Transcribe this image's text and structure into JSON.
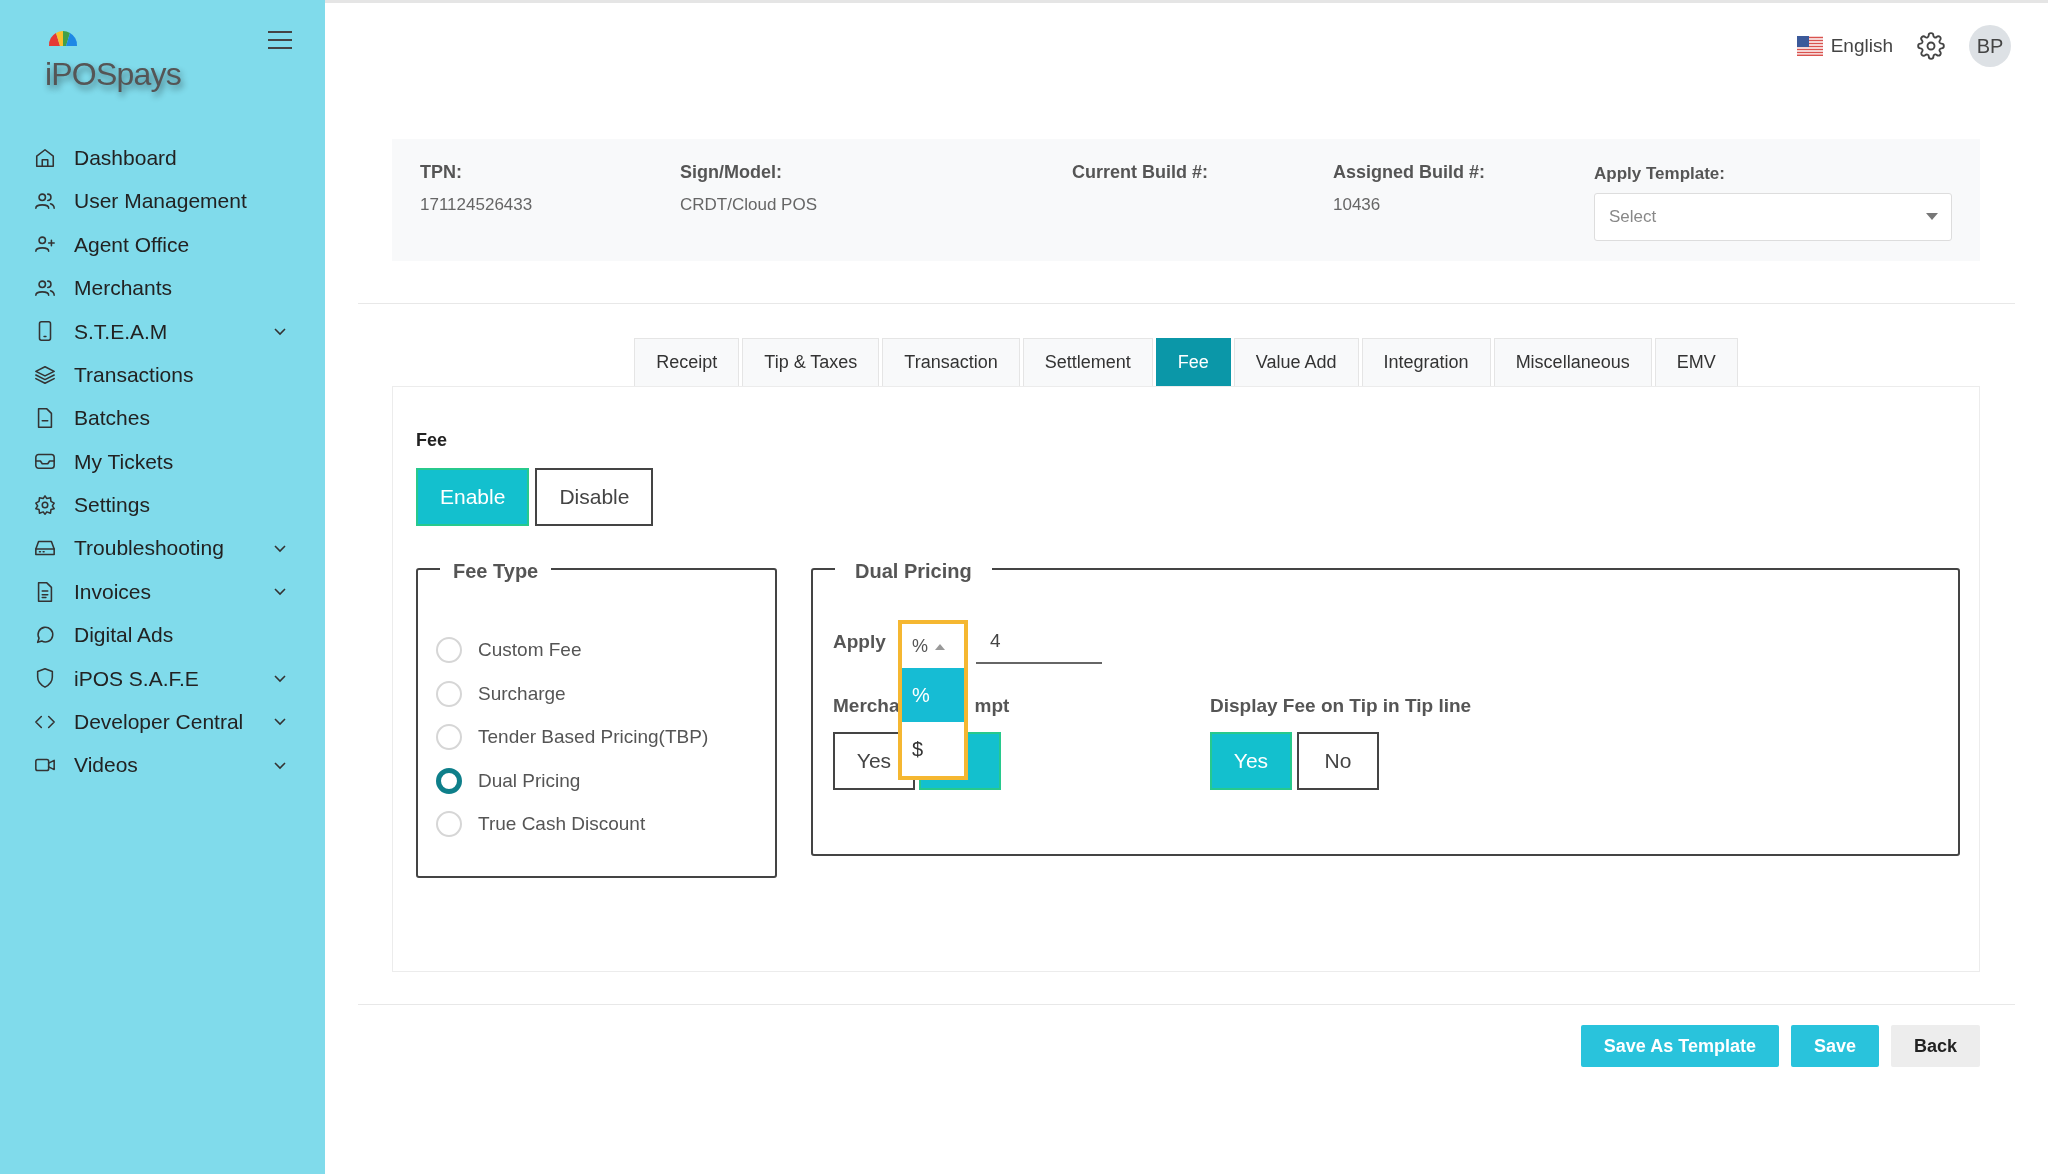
{
  "sidebar": {
    "logo": "iPOSpays",
    "items": [
      {
        "label": "Dashboard",
        "expandable": false
      },
      {
        "label": "User Management",
        "expandable": false
      },
      {
        "label": "Agent Office",
        "expandable": false
      },
      {
        "label": "Merchants",
        "expandable": false
      },
      {
        "label": "S.T.E.A.M",
        "expandable": true
      },
      {
        "label": "Transactions",
        "expandable": false
      },
      {
        "label": "Batches",
        "expandable": false
      },
      {
        "label": "My Tickets",
        "expandable": false
      },
      {
        "label": "Settings",
        "expandable": false
      },
      {
        "label": "Troubleshooting",
        "expandable": true
      },
      {
        "label": "Invoices",
        "expandable": true
      },
      {
        "label": "Digital Ads",
        "expandable": false
      },
      {
        "label": "iPOS S.A.F.E",
        "expandable": true
      },
      {
        "label": "Developer Central",
        "expandable": true
      },
      {
        "label": "Videos",
        "expandable": true
      }
    ]
  },
  "header": {
    "language": "English",
    "avatar": "BP"
  },
  "info": [
    {
      "label": "TPN:",
      "value": "171124526433"
    },
    {
      "label": "Sign/Model:",
      "value": "CRDT/Cloud POS"
    },
    {
      "label": "Current Build #:"
    },
    {
      "label": "Assigned Build #:",
      "value": "10436"
    }
  ],
  "apply_template": {
    "label": "Apply Template:",
    "placeholder": "Select"
  },
  "tabs": [
    {
      "label": "Receipt",
      "selected": false
    },
    {
      "label": "Tip & Taxes",
      "selected": false
    },
    {
      "label": "Transaction",
      "selected": false
    },
    {
      "label": "Settlement",
      "selected": false
    },
    {
      "label": "Fee",
      "selected": true
    },
    {
      "label": "Value Add",
      "selected": false
    },
    {
      "label": "Integration",
      "selected": false
    },
    {
      "label": "Miscellaneous",
      "selected": false
    },
    {
      "label": "EMV",
      "selected": false
    }
  ],
  "fee": {
    "title": "Fee",
    "toggle": [
      {
        "label": "Enable",
        "selected": true
      },
      {
        "label": "Disable",
        "selected": false
      }
    ],
    "fee_type": {
      "legend": "Fee Type",
      "options": [
        {
          "label": "Custom Fee",
          "selected": false
        },
        {
          "label": "Surcharge",
          "selected": false
        },
        {
          "label": "Tender Based Pricing(TBP)",
          "selected": false
        },
        {
          "label": "Dual Pricing",
          "selected": true
        },
        {
          "label": "True Cash Discount",
          "selected": false
        }
      ]
    },
    "dual_pricing": {
      "legend": "Dual Pricing",
      "apply_label": "Apply",
      "unit": "%",
      "value": "4",
      "unit_menu": [
        {
          "label": "%",
          "selected": true
        },
        {
          "label": "$",
          "selected": false
        }
      ],
      "merchant_exempt": {
        "label_parts": [
          "Mercha",
          "mpt"
        ],
        "buttons": [
          {
            "label": "Yes",
            "selected": false
          },
          {
            "selected": true
          }
        ]
      },
      "display_fee": {
        "label": "Display Fee on Tip in Tip line",
        "buttons": [
          {
            "label": "Yes",
            "selected": true
          },
          {
            "label": "No",
            "selected": false
          }
        ]
      }
    }
  },
  "actions": [
    {
      "label": "Save As Template",
      "kind": "primary"
    },
    {
      "label": "Save",
      "kind": "primary"
    },
    {
      "label": "Back",
      "kind": "secondary"
    }
  ]
}
